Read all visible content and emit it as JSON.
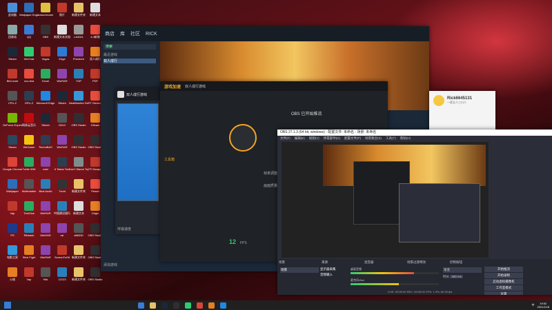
{
  "desktop": {
    "icons": [
      {
        "label": "此电脑",
        "color": "#4a90d9"
      },
      {
        "label": "Wallpaper Engine",
        "color": "#2a6fb8"
      },
      {
        "label": "colorchecker",
        "color": "#e0c040"
      },
      {
        "label": "照片",
        "color": "#c0392b"
      },
      {
        "label": "新建文件夹",
        "color": "#e8c26a"
      },
      {
        "label": "新建文本",
        "color": "#ddd"
      },
      {
        "label": "回收站",
        "color": "#8aa"
      },
      {
        "label": "QQ",
        "color": "#3a7bd5"
      },
      {
        "label": "OBS",
        "color": "#333"
      },
      {
        "label": "新建文本文档",
        "color": "#ddd"
      },
      {
        "label": "LA3041",
        "color": "#999"
      },
      {
        "label": "4.0新增",
        "color": "#e74c3c"
      },
      {
        "label": "Steam",
        "color": "#1b2838"
      },
      {
        "label": "WeChat",
        "color": "#2ecc71"
      },
      {
        "label": "Vegas",
        "color": "#c0392b"
      },
      {
        "label": "Edge",
        "color": "#2b7bd6"
      },
      {
        "label": "Premiere",
        "color": "#8e44ad"
      },
      {
        "label": "双人成行",
        "color": "#e67e22"
      }
    ],
    "extra_icons": [
      {
        "label": "BitComet",
        "color": "#c0392b"
      },
      {
        "label": "nox-test",
        "color": "#e74c3c"
      },
      {
        "label": "Excel",
        "color": "#27ae60"
      },
      {
        "label": "WinRAR",
        "color": "#8e44ad"
      },
      {
        "label": "TGP",
        "color": "#2980b9"
      },
      {
        "label": "PDF",
        "color": "#c0392b"
      },
      {
        "label": "CPU-Z",
        "color": "#555"
      },
      {
        "label": "GPU-Z",
        "color": "#2c3e50"
      },
      {
        "label": "Microsoft Edge",
        "color": "#1e88e5"
      },
      {
        "label": "Steam",
        "color": "#1b2838"
      },
      {
        "label": "NeatMonitor Desk Transp",
        "color": "#3498db"
      },
      {
        "label": "FF General",
        "color": "#e74c3c"
      },
      {
        "label": "GeForce Experience",
        "color": "#76b900"
      },
      {
        "label": "网易云音乐",
        "color": "#c20c0c"
      },
      {
        "label": "Steam",
        "color": "#1b2838"
      },
      {
        "label": "DDUI",
        "color": "#555"
      },
      {
        "label": "OBS Studio",
        "color": "#302e31"
      },
      {
        "label": "Gifcam",
        "color": "#e67e22"
      },
      {
        "label": "Steam",
        "color": "#2a475e"
      },
      {
        "label": "WeGame",
        "color": "#f1c40f"
      },
      {
        "label": "TechniBAS",
        "color": "#2c3e50"
      },
      {
        "label": "WinRAR",
        "color": "#8e44ad"
      },
      {
        "label": "OBS Studio",
        "color": "#302e31"
      },
      {
        "label": "OBS Studio",
        "color": "#302e31"
      },
      {
        "label": "Google Chrome",
        "color": "#db4437"
      },
      {
        "label": "Turtle WW",
        "color": "#27ae60"
      },
      {
        "label": "cctcl",
        "color": "#8e44ad"
      },
      {
        "label": "It Takes Two",
        "color": "#2c3e50"
      },
      {
        "label": "Don't Starve Together",
        "color": "#7f8c8d"
      },
      {
        "label": "FF Escape",
        "color": "#c0392b"
      },
      {
        "label": "Wallpaper",
        "color": "#2a6fb8"
      },
      {
        "label": "Wolfenstein",
        "color": "#555"
      },
      {
        "label": "Best Audio",
        "color": "#2980b9"
      },
      {
        "label": "7cmd",
        "color": "#333"
      },
      {
        "label": "新建文件夹",
        "color": "#e8c26a"
      },
      {
        "label": "Peach",
        "color": "#e74c3c"
      },
      {
        "label": "Vap",
        "color": "#c0392b"
      },
      {
        "label": "TreeSize",
        "color": "#27ae60"
      },
      {
        "label": "WinRAR",
        "color": "#8e44ad"
      },
      {
        "label": "中国建设银行",
        "color": "#2980b9"
      },
      {
        "label": "新建文本",
        "color": "#ddd"
      },
      {
        "label": "Origin",
        "color": "#e67e22"
      },
      {
        "label": "PS",
        "color": "#1e3a8a"
      },
      {
        "label": "Ribbank",
        "color": "#2980b9"
      },
      {
        "label": "WinRAR",
        "color": "#8e44ad"
      },
      {
        "label": "rar",
        "color": "#8e44ad"
      },
      {
        "label": "a86330",
        "color": "#555"
      },
      {
        "label": "OBS Studio",
        "color": "#302e31"
      },
      {
        "label": "电影之家",
        "color": "#3498db"
      },
      {
        "label": "Stick Fight",
        "color": "#e67e22"
      },
      {
        "label": "WinRAR",
        "color": "#8e44ad"
      },
      {
        "label": "ScreenToGif",
        "color": "#c0392b"
      },
      {
        "label": "新建文件夹",
        "color": "#e8c26a"
      },
      {
        "label": "OBS Studio",
        "color": "#302e31"
      },
      {
        "label": "火绒",
        "color": "#e67e22"
      },
      {
        "label": "Vap",
        "color": "#c0392b"
      },
      {
        "label": "Hisi",
        "color": "#555"
      },
      {
        "label": "12123",
        "color": "#2980b9"
      },
      {
        "label": "新建文件夹",
        "color": "#e8c26a"
      },
      {
        "label": "OBS Studio",
        "color": "#302e31"
      }
    ]
  },
  "steam": {
    "nav": [
      "商店",
      "库",
      "社区",
      "RICK"
    ],
    "sidebar_items": [
      "最近游戏",
      "双人成行"
    ],
    "search_placeholder": "搜索",
    "footer_left": "添加游戏",
    "footer_right": "下载"
  },
  "game": {
    "title": "双人成行游戏",
    "brand": "游戏加速",
    "status": "OBS 已开始推流",
    "accent": "#f5a623",
    "stats": [
      "帧率调整",
      "画面质量"
    ],
    "counter": "12",
    "counter_unit": "FPS"
  },
  "tencent": {
    "title": "双人成行游戏",
    "tool_header": "工具箱",
    "bottom_text": "传输速度"
  },
  "obs": {
    "title": "OBS 27.1.3 (64 bit, windows) - 配置文件: 未命名 - 场景: 未命名",
    "menu": [
      "文件(F)",
      "编辑(E)",
      "视图(V)",
      "停靠部件(D)",
      "配置文件(P)",
      "场景集合(S)",
      "工具(T)",
      "帮助(H)"
    ],
    "docks": [
      "场景",
      "来源",
      "混音器",
      "场景过渡特效",
      "控制按钮"
    ],
    "scene_item": "场景",
    "source_items": [
      "显示器采集",
      "音频输入"
    ],
    "mixer": [
      {
        "name": "桌面音频",
        "level": 0.72,
        "db": "0.0 dB"
      },
      {
        "name": "麦克风/Aux",
        "level": 0.55,
        "db": "0.0 dB"
      }
    ],
    "transition": "渐变",
    "duration_label": "时长",
    "duration": "300 ms",
    "controls": [
      "开始推流",
      "开始录制",
      "启动虚拟摄像机",
      "工作室模式",
      "设置",
      "退出"
    ],
    "status": "LIVE: 00:00:00  REC: 00:00:00  CPU: 1.3%, 60.00 fps"
  },
  "qq": {
    "name": "Rick6645131",
    "status": "一家五人三口人"
  },
  "taskbar": {
    "time": "19:52",
    "date": "2021/11/8",
    "tray_text": "中",
    "colors": [
      "#3a7bd5",
      "#e8c26a",
      "#1b2838",
      "#302e31",
      "#2ecc71",
      "#db4437",
      "#e67e22",
      "#1e88e5"
    ]
  }
}
